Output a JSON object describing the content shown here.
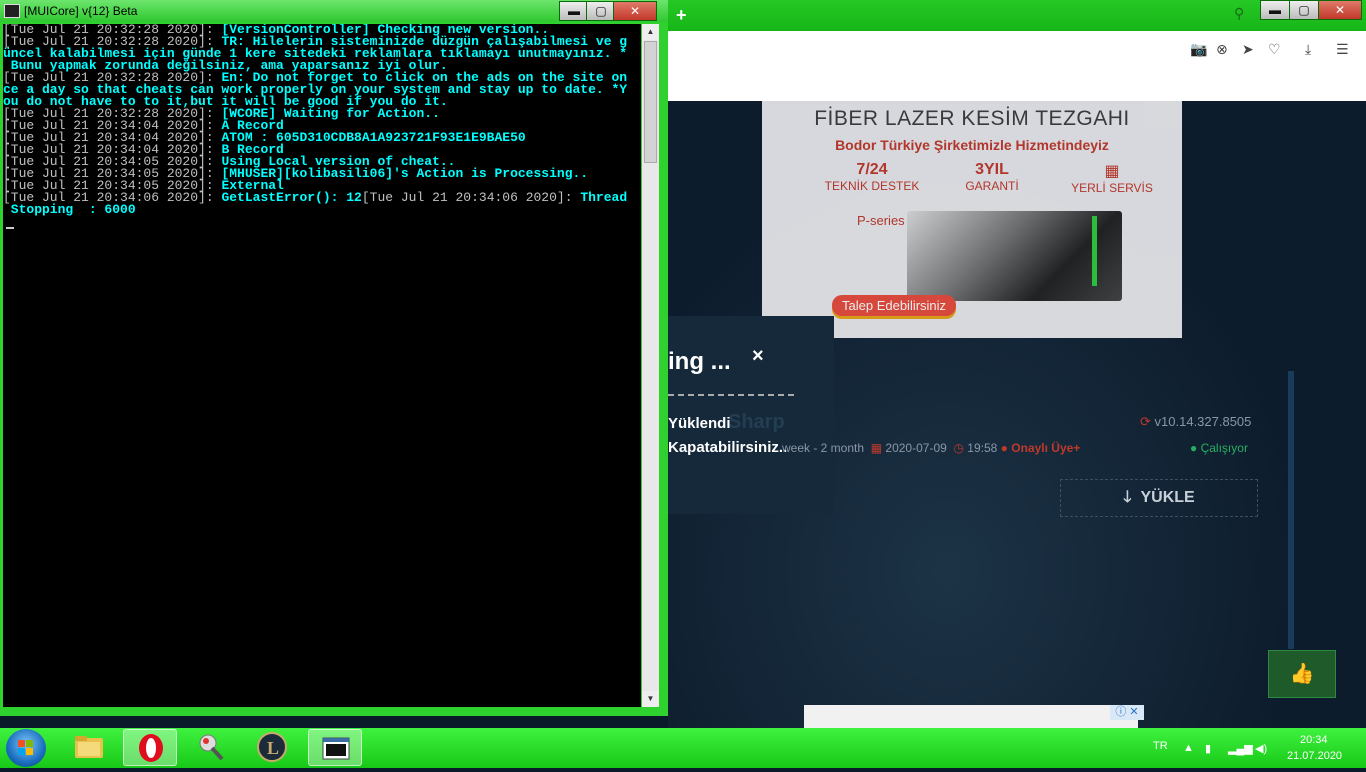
{
  "console": {
    "title": "[MUICore] v{12} Beta",
    "controls": {
      "minimize": "▬",
      "maximize": "▢",
      "close": "✕"
    },
    "lines": [
      {
        "ts": "[Tue Jul 21 20:32:28 2020]: ",
        "msg": "[VersionController] Checking new version.."
      },
      {
        "ts": "[Tue Jul 21 20:32:28 2020]: ",
        "msg": "TR: Hilelerin sisteminizde düzgün çalışabilmesi ve g"
      },
      {
        "ts": "",
        "msg": "üncel kalabilmesi için günde 1 kere sitedeki reklamlara tıklamayı unutmayınız. *"
      },
      {
        "ts": "",
        "msg": " Bunu yapmak zorunda değilsiniz, ama yaparsanız iyi olur."
      },
      {
        "ts": "[Tue Jul 21 20:32:28 2020]: ",
        "msg": "En: Do not forget to click on the ads on the site on"
      },
      {
        "ts": "",
        "msg": "ce a day so that cheats can work properly on your system and stay up to date. *Y"
      },
      {
        "ts": "",
        "msg": "ou do not have to to it,but it will be good if you do it."
      },
      {
        "ts": "[Tue Jul 21 20:32:28 2020]: ",
        "msg": "[WCORE] Waiting for Action.."
      },
      {
        "ts": "[Tue Jul 21 20:34:04 2020]: ",
        "msg": "A Record"
      },
      {
        "ts": "[Tue Jul 21 20:34:04 2020]: ",
        "msg": "ATOM : 605D310CDB8A1A923721F93E1E9BAE50"
      },
      {
        "ts": "[Tue Jul 21 20:34:04 2020]: ",
        "msg": "B Record"
      },
      {
        "ts": "[Tue Jul 21 20:34:05 2020]: ",
        "msg": "Using Local version of cheat.."
      },
      {
        "ts": "[Tue Jul 21 20:34:05 2020]: ",
        "msg": "[MHUSER][kolibasili06]'s Action is Processing.."
      },
      {
        "ts": "[Tue Jul 21 20:34:05 2020]: ",
        "msg": "External"
      },
      {
        "ts": "[Tue Jul 21 20:34:06 2020]: ",
        "msg": "GetLastError(): 12",
        "ts2": "[Tue Jul 21 20:34:06 2020]: ",
        "msg2": "Thread"
      },
      {
        "ts": "",
        "msg": " Stopping  : 6000"
      }
    ]
  },
  "browser": {
    "new_tab": "+",
    "search_icon": "search-icon",
    "controls": {
      "minimize": "▬",
      "maximize": "▢",
      "close": "✕"
    },
    "toolbar_icons": [
      "camera-icon",
      "block-icon",
      "send-icon",
      "heart-icon",
      "download-icon",
      "menu-icon"
    ],
    "toolbar_glyphs": [
      "📷",
      "⊗",
      "➤",
      "♡",
      "⤓",
      "☰"
    ],
    "ad": {
      "title": "FİBER LAZER KESİM TEZGAHI",
      "subtitle": "Bodor Türkiye  Şirketimizle Hizmetindeyiz",
      "features": [
        {
          "big": "7/24",
          "small": "TEKNİK DESTEK"
        },
        {
          "big": "3YIL",
          "small": "GARANTİ"
        },
        {
          "big": "",
          "small": "YERLİ SERVİS"
        }
      ],
      "series": "P-series",
      "cta": "Talep Edebilirsiniz"
    },
    "popup": {
      "title": "ing ...",
      "close": "×",
      "loaded": "Yüklendi",
      "loaded_ghost": "Sharp",
      "can_run": "Kapatabilirsiniz.."
    },
    "meta": {
      "period": "week - 2 month",
      "date": "2020-07-09",
      "time": "19:58",
      "role": "Onaylı Üye+"
    },
    "version": "v10.14.327.8505",
    "status": "Çalışıyor",
    "download_label": "YÜKLE",
    "like_icon": "thumbs-up-icon",
    "adchoice": "ⓘ ✕"
  },
  "taskbar": {
    "apps": [
      "file-explorer",
      "opera-browser",
      "tool-app",
      "league-of-legends",
      "console-window"
    ],
    "language": "TR",
    "time": "20:34",
    "date": "21.07.2020"
  },
  "colors": {
    "console_text": "#00ffff",
    "console_timestamp": "#c0c0c0",
    "taskbar": "#22d622",
    "accent_red": "#c0392b",
    "status_green": "#27ae60"
  }
}
